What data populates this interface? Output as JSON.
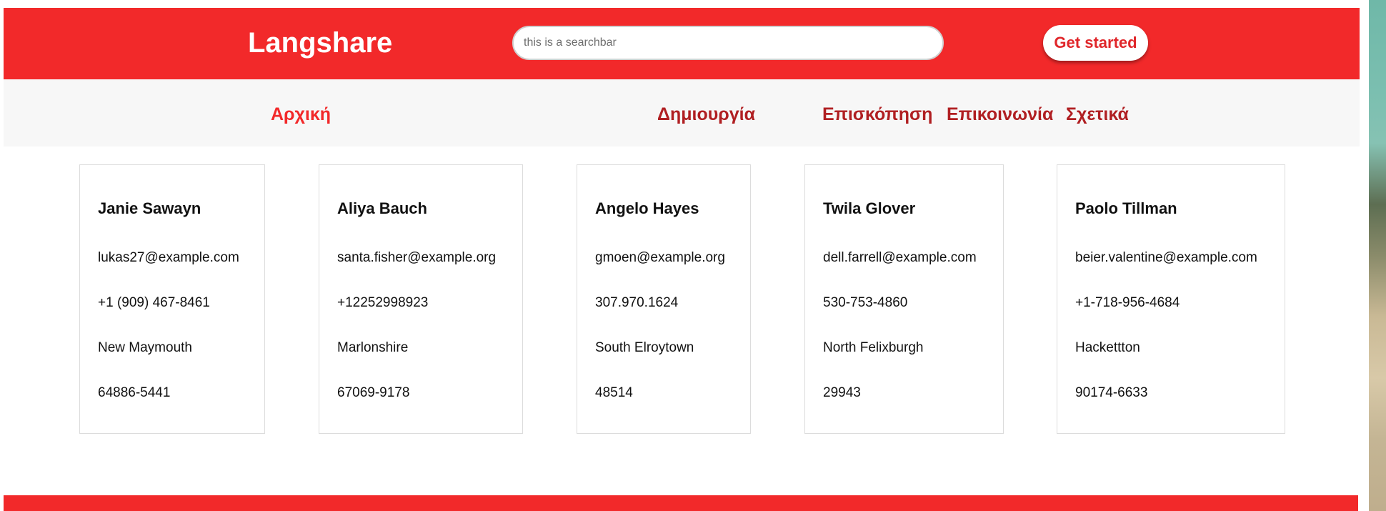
{
  "header": {
    "logo": "Langshare",
    "search_placeholder": "this is a searchbar",
    "cta_label": "Get started",
    "brand_color": "#f2292a"
  },
  "nav": {
    "items": [
      {
        "label": "Αρχική",
        "active": true
      },
      {
        "label": "Δημιουργία",
        "active": false
      },
      {
        "label": "Επισκόπηση",
        "active": false
      },
      {
        "label": "Επικοινωνία",
        "active": false
      },
      {
        "label": "Σχετικά",
        "active": false
      }
    ]
  },
  "cards": [
    {
      "name": "Janie Sawayn",
      "email": "lukas27@example.com",
      "phone": "+1 (909) 467-8461",
      "city": "New Maymouth",
      "zip": "64886-5441"
    },
    {
      "name": "Aliya Bauch",
      "email": "santa.fisher@example.org",
      "phone": "+12252998923",
      "city": "Marlonshire",
      "zip": "67069-9178"
    },
    {
      "name": "Angelo Hayes",
      "email": "gmoen@example.org",
      "phone": "307.970.1624",
      "city": "South Elroytown",
      "zip": "48514"
    },
    {
      "name": "Twila Glover",
      "email": "dell.farrell@example.com",
      "phone": "530-753-4860",
      "city": "North Felixburgh",
      "zip": "29943"
    },
    {
      "name": "Paolo Tillman",
      "email": "beier.valentine@example.com",
      "phone": "+1-718-956-4684",
      "city": "Hackettton",
      "zip": "90174-6633"
    }
  ]
}
